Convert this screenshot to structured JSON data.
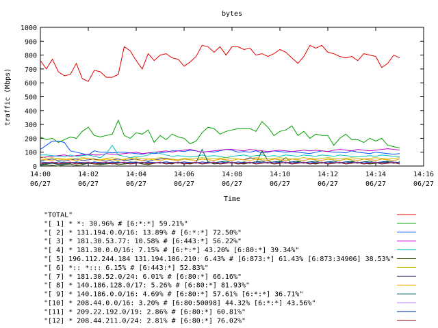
{
  "chart_data": {
    "type": "line",
    "title": "bytes",
    "xlabel": "Time",
    "ylabel": "traffic (Mbps)",
    "ylim": [
      0,
      1000
    ],
    "xlim": [
      "14:00",
      "14:16"
    ],
    "yticks": [
      0,
      100,
      200,
      300,
      400,
      500,
      600,
      700,
      800,
      900,
      1000
    ],
    "xticks": [
      {
        "time": "14:00",
        "date": "06/27"
      },
      {
        "time": "14:02",
        "date": "06/27"
      },
      {
        "time": "14:04",
        "date": "06/27"
      },
      {
        "time": "14:06",
        "date": "06/27"
      },
      {
        "time": "14:08",
        "date": "06/27"
      },
      {
        "time": "14:10",
        "date": "06/27"
      },
      {
        "time": "14:12",
        "date": "06/27"
      },
      {
        "time": "14:14",
        "date": "06/27"
      },
      {
        "time": "14:16",
        "date": "06/27"
      }
    ],
    "grid": false,
    "legend_position": "bottom",
    "x_minutes": [
      0,
      0.25,
      0.5,
      0.75,
      1,
      1.25,
      1.5,
      1.75,
      2,
      2.25,
      2.5,
      2.75,
      3,
      3.25,
      3.5,
      3.75,
      4,
      4.25,
      4.5,
      4.75,
      5,
      5.25,
      5.5,
      5.75,
      6,
      6.25,
      6.5,
      6.75,
      7,
      7.25,
      7.5,
      7.75,
      8,
      8.25,
      8.5,
      8.75,
      9,
      9.25,
      9.5,
      9.75,
      10,
      10.25,
      10.5,
      10.75,
      11,
      11.25,
      11.5,
      11.75,
      12,
      12.25,
      12.5,
      12.75,
      13,
      13.25,
      13.5,
      13.75,
      14,
      14.25,
      14.5,
      14.75,
      15
    ],
    "series": [
      {
        "name": "\"TOTAL\"",
        "color": "#e00000",
        "values": [
          760,
          700,
          770,
          680,
          650,
          660,
          740,
          630,
          610,
          690,
          680,
          640,
          640,
          660,
          860,
          830,
          760,
          700,
          810,
          760,
          800,
          810,
          780,
          770,
          720,
          750,
          790,
          870,
          860,
          820,
          860,
          800,
          860,
          860,
          840,
          850,
          800,
          810,
          790,
          810,
          840,
          820,
          780,
          740,
          790,
          870,
          850,
          870,
          820,
          810,
          790,
          780,
          790,
          760,
          810,
          800,
          790,
          710,
          740,
          800,
          780
        ]
      },
      {
        "name": "\"[ 1] * *: 30.96% # [6:*:*] 59.21%\"",
        "color": "#00a000",
        "values": [
          210,
          190,
          200,
          170,
          190,
          210,
          200,
          250,
          280,
          220,
          210,
          220,
          230,
          330,
          220,
          200,
          240,
          230,
          260,
          170,
          220,
          190,
          230,
          210,
          200,
          160,
          180,
          240,
          280,
          270,
          230,
          250,
          260,
          270,
          270,
          270,
          250,
          320,
          280,
          220,
          250,
          260,
          290,
          220,
          250,
          200,
          230,
          220,
          220,
          150,
          200,
          230,
          190,
          190,
          170,
          200,
          180,
          200,
          150,
          140,
          130
        ]
      },
      {
        "name": "\"[ 2] * 131.194.0.0/16: 13.89% # [6:*:*] 72.50%\"",
        "color": "#0050ff",
        "values": [
          120,
          150,
          180,
          180,
          170,
          110,
          100,
          90,
          80,
          110,
          100,
          100,
          95,
          100,
          100,
          95,
          90,
          85,
          95,
          90,
          95,
          100,
          110,
          110,
          105,
          115,
          110,
          100,
          105,
          100,
          110,
          120,
          115,
          100,
          105,
          100,
          110,
          95,
          100,
          110,
          105,
          100,
          105,
          100,
          95,
          90,
          100,
          110,
          105,
          100,
          100,
          95,
          110,
          100,
          95,
          90,
          100,
          95,
          90,
          85,
          90
        ]
      },
      {
        "name": "\"[ 3] * 181.30.53.77: 10.58% # [6:443:*] 56.22%\"",
        "color": "#c000c0",
        "values": [
          60,
          65,
          70,
          75,
          80,
          70,
          75,
          80,
          85,
          80,
          80,
          90,
          85,
          85,
          90,
          95,
          100,
          90,
          95,
          100,
          105,
          110,
          100,
          110,
          115,
          120,
          110,
          100,
          105,
          110,
          115,
          120,
          120,
          115,
          110,
          120,
          115,
          110,
          105,
          110,
          115,
          110,
          105,
          110,
          115,
          110,
          115,
          110,
          105,
          115,
          120,
          115,
          110,
          120,
          115,
          110,
          115,
          120,
          125,
          120,
          115
        ]
      },
      {
        "name": "\"[ 4] * 181.30.0.0/16: 7.15% # [6:*:*] 43.20% [6:80:*] 39.34%\"",
        "color": "#00c0c0",
        "values": [
          80,
          80,
          75,
          70,
          65,
          80,
          70,
          75,
          80,
          70,
          60,
          90,
          150,
          80,
          70,
          60,
          70,
          70,
          80,
          100,
          90,
          80,
          70,
          75,
          70,
          65,
          70,
          80,
          70,
          75,
          70,
          60,
          70,
          75,
          80,
          70,
          75,
          80,
          70,
          75,
          70,
          80,
          75,
          70,
          80,
          75,
          70,
          80,
          75,
          70,
          80,
          75,
          70,
          65,
          70,
          75,
          70,
          80,
          75,
          70,
          65
        ]
      },
      {
        "name": "\"[ 5] 196.112.244.184 131.194.106.210: 6.43% # [6:873:*] 61.43% [6:873:34906] 38.53%\"",
        "color": "#305000",
        "values": [
          5,
          10,
          5,
          0,
          10,
          15,
          5,
          10,
          20,
          15,
          10,
          15,
          20,
          10,
          15,
          20,
          25,
          15,
          10,
          20,
          25,
          20,
          15,
          30,
          20,
          15,
          25,
          20,
          30,
          15,
          20,
          25,
          30,
          20,
          15,
          25,
          20,
          110,
          40,
          20,
          30,
          60,
          20,
          30,
          25,
          20,
          15,
          25,
          30,
          20,
          25,
          20,
          30,
          25,
          20,
          15,
          20,
          25,
          30,
          20,
          25
        ]
      },
      {
        "name": "\"[ 6] *:: *::: 6.15% # [6:443:*] 52.83%\"",
        "color": "#c0c000",
        "values": [
          70,
          55,
          60,
          50,
          45,
          55,
          50,
          60,
          55,
          50,
          45,
          55,
          60,
          50,
          45,
          55,
          60,
          55,
          50,
          55,
          60,
          55,
          50,
          45,
          55,
          50,
          55,
          60,
          55,
          50,
          55,
          60,
          55,
          50,
          45,
          55,
          60,
          55,
          50,
          55,
          60,
          55,
          50,
          55,
          60,
          55,
          50,
          55,
          60,
          55,
          50,
          55,
          60,
          55,
          50,
          55,
          60,
          55,
          50,
          55,
          60
        ]
      },
      {
        "name": "\"[ 7] * 181.30.52.0/24: 6.01% # [6:80:*] 66.16%\"",
        "color": "#404080",
        "values": [
          40,
          45,
          50,
          40,
          35,
          45,
          50,
          40,
          45,
          50,
          40,
          35,
          45,
          50,
          40,
          45,
          50,
          40,
          35,
          45,
          50,
          55,
          45,
          40,
          50,
          45,
          40,
          50,
          45,
          40,
          50,
          45,
          40,
          50,
          45,
          60,
          50,
          45,
          40,
          50,
          45,
          40,
          50,
          45,
          40,
          50,
          45,
          40,
          50,
          45,
          40,
          50,
          45,
          40,
          50,
          45,
          40,
          50,
          45,
          40,
          50
        ]
      },
      {
        "name": "\"[ 8] * 140.186.128.0/17: 5.26% # [6:80:*] 81.93%\"",
        "color": "#ffb000",
        "values": [
          50,
          45,
          40,
          55,
          50,
          45,
          40,
          50,
          55,
          45,
          40,
          50,
          45,
          40,
          50,
          55,
          45,
          40,
          50,
          45,
          40,
          50,
          45,
          40,
          50,
          45,
          40,
          50,
          45,
          40,
          50,
          45,
          40,
          50,
          45,
          40,
          50,
          45,
          40,
          50,
          45,
          40,
          50,
          45,
          40,
          50,
          45,
          40,
          50,
          45,
          40,
          50,
          45,
          40,
          50,
          45,
          40,
          50,
          45,
          40,
          50
        ]
      },
      {
        "name": "\"[ 9] * 140.186.0.0/16: 4.69% # [6:80:*] 57.61% [6:*:*] 36.71%\"",
        "color": "#006060",
        "values": [
          10,
          15,
          20,
          10,
          15,
          20,
          25,
          15,
          20,
          25,
          15,
          20,
          25,
          30,
          20,
          25,
          30,
          20,
          25,
          20,
          25,
          30,
          20,
          25,
          30,
          20,
          25,
          120,
          30,
          25,
          30,
          35,
          25,
          20,
          30,
          25,
          30,
          35,
          25,
          30,
          35,
          25,
          30,
          35,
          25,
          30,
          35,
          25,
          30,
          35,
          25,
          30,
          35,
          25,
          30,
          35,
          25,
          30,
          35,
          30,
          25
        ]
      },
      {
        "name": "\"[10] * 208.44.0.0/16: 3.20% # [6:80:50098] 44.32% [6:*:*] 43.56%\"",
        "color": "#c080ff",
        "values": [
          20,
          25,
          30,
          20,
          25,
          30,
          20,
          25,
          30,
          20,
          25,
          30,
          20,
          25,
          30,
          20,
          25,
          30,
          20,
          25,
          30,
          20,
          25,
          30,
          20,
          25,
          30,
          20,
          25,
          30,
          20,
          25,
          30,
          20,
          25,
          30,
          20,
          25,
          30,
          20,
          25,
          30,
          20,
          25,
          30,
          20,
          25,
          30,
          20,
          25,
          30,
          20,
          25,
          30,
          20,
          25,
          30,
          20,
          25,
          30,
          20
        ]
      },
      {
        "name": "\"[11] * 209.22.192.0/19: 2.86% # [6:80:*] 60.81%\"",
        "color": "#0030a0",
        "values": [
          30,
          25,
          20,
          30,
          25,
          20,
          30,
          25,
          20,
          30,
          25,
          20,
          30,
          25,
          20,
          30,
          25,
          20,
          30,
          25,
          20,
          30,
          25,
          20,
          30,
          25,
          20,
          30,
          25,
          20,
          30,
          25,
          20,
          30,
          25,
          20,
          30,
          25,
          20,
          30,
          25,
          20,
          30,
          25,
          20,
          30,
          25,
          20,
          30,
          25,
          20,
          30,
          25,
          20,
          30,
          25,
          20,
          30,
          25,
          20,
          30
        ]
      },
      {
        "name": "\"[12] * 208.44.211.0/24: 2.81% # [6:80:*] 76.02%\"",
        "color": "#800000",
        "values": [
          15,
          20,
          25,
          15,
          20,
          25,
          15,
          20,
          25,
          15,
          20,
          25,
          15,
          20,
          25,
          15,
          20,
          25,
          15,
          20,
          25,
          15,
          20,
          25,
          15,
          20,
          25,
          15,
          20,
          25,
          15,
          20,
          25,
          15,
          20,
          25,
          15,
          20,
          25,
          15,
          20,
          25,
          15,
          20,
          25,
          15,
          20,
          25,
          15,
          20,
          25,
          15,
          20,
          25,
          15,
          20,
          25,
          15,
          20,
          25,
          15
        ]
      }
    ]
  }
}
